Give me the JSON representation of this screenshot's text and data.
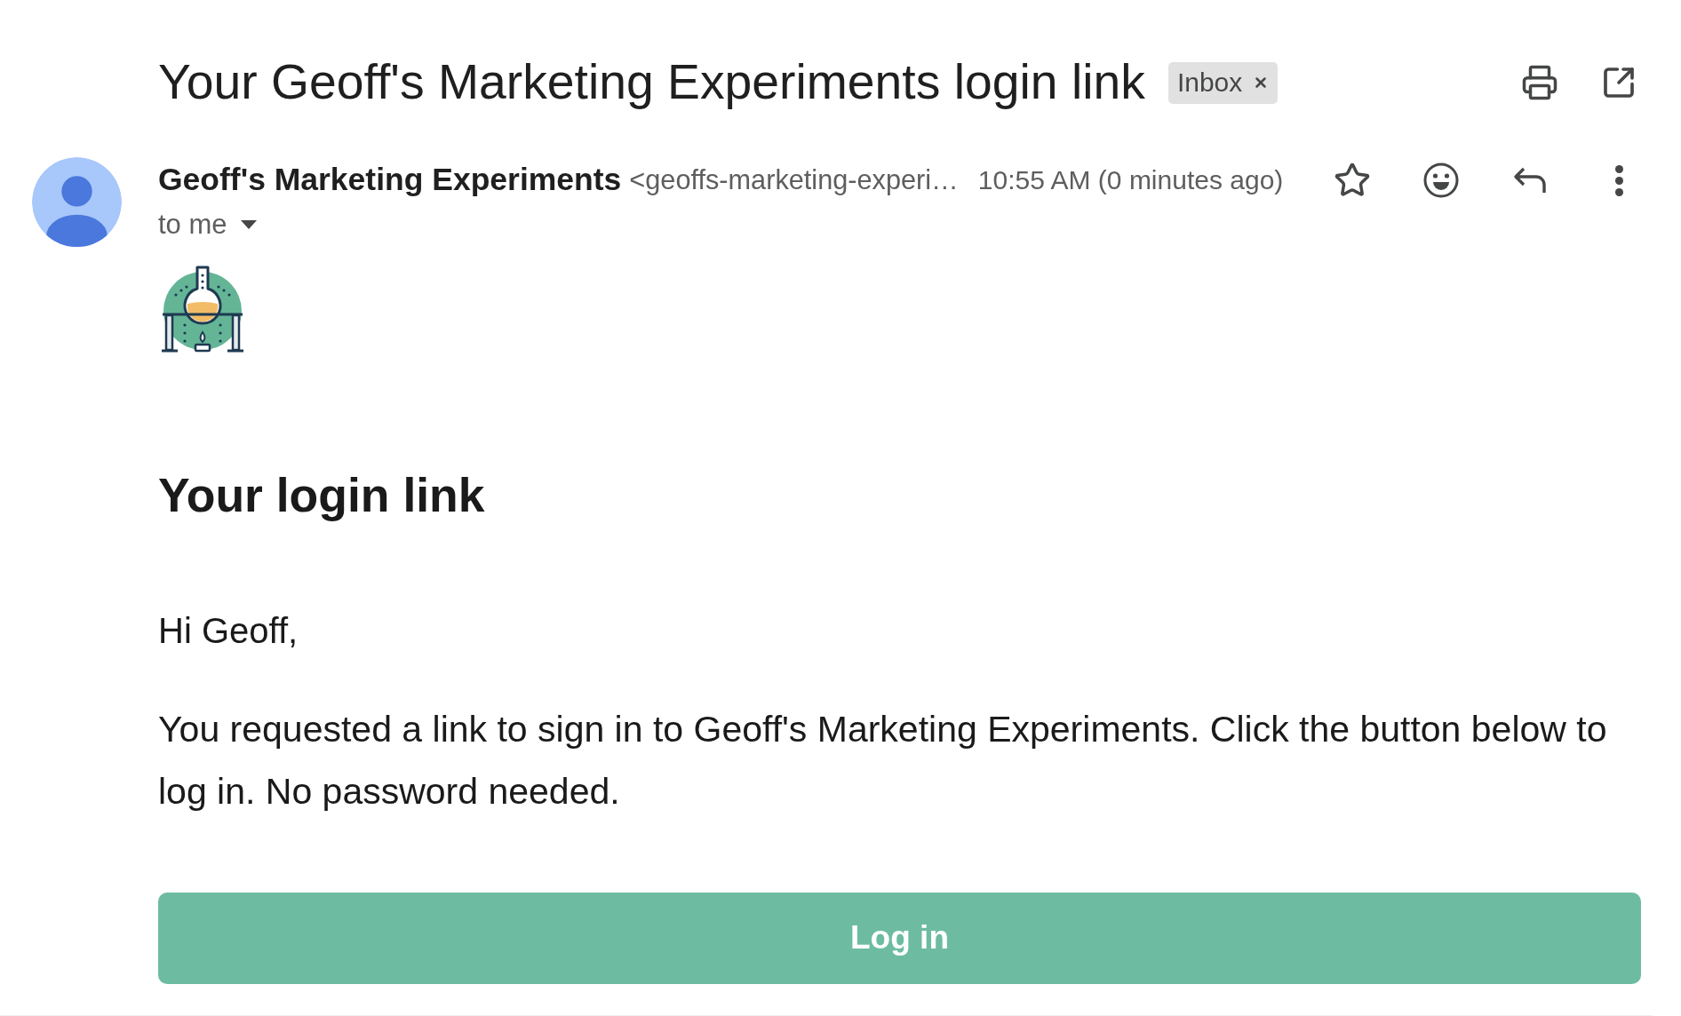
{
  "subject": {
    "title": "Your Geoff's Marketing Experiments login link",
    "labels": [
      {
        "text": "Inbox"
      }
    ]
  },
  "message": {
    "sender_name": "Geoff's Marketing Experiments",
    "sender_email": "<geoffs-marketing-experi…",
    "time": "10:55 AM (0 minutes ago)",
    "recipients": "to me",
    "starred": false
  },
  "body": {
    "heading": "Your login link",
    "greeting": "Hi Geoff,",
    "paragraph": "You requested a link to sign in to Geoff's Marketing Experiments. Click the button below to log in. No password needed.",
    "button": "Log in"
  }
}
